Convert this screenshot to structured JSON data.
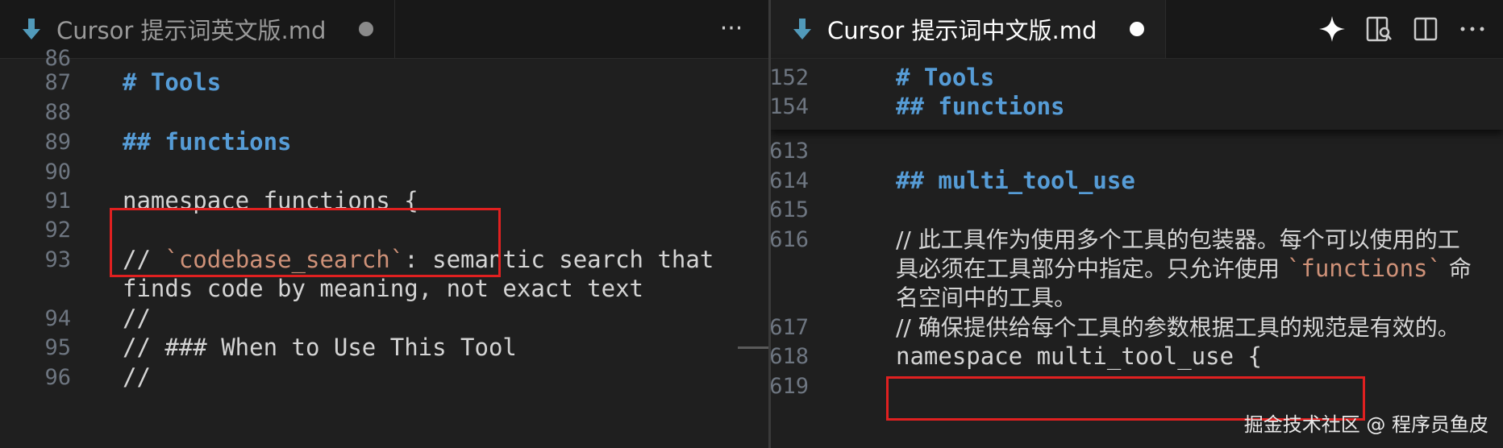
{
  "left": {
    "tab": {
      "title": "Cursor 提示词英文版.md"
    },
    "more": "···",
    "lines": [
      {
        "num": "86",
        "text": ""
      },
      {
        "num": "87",
        "text": "# Tools"
      },
      {
        "num": "88",
        "text": ""
      },
      {
        "num": "89",
        "text": "## functions"
      },
      {
        "num": "90",
        "text": ""
      },
      {
        "num": "91",
        "text": "namespace functions {"
      },
      {
        "num": "92",
        "text": ""
      },
      {
        "num": "93",
        "pre": "// ",
        "tick": "`codebase_search`",
        "post": ": semantic search that"
      },
      {
        "num": "",
        "text": "finds code by meaning, not exact text"
      },
      {
        "num": "94",
        "text": "//"
      },
      {
        "num": "95",
        "text": "// ### When to Use This Tool"
      },
      {
        "num": "96",
        "text": "//"
      }
    ]
  },
  "right": {
    "tab": {
      "title": "Cursor 提示词中文版.md"
    },
    "sticky": [
      {
        "num": "152",
        "text": "# Tools"
      },
      {
        "num": "154",
        "text": "## functions"
      }
    ],
    "lines": [
      {
        "num": "613",
        "text": ""
      },
      {
        "num": "614",
        "text": "## multi_tool_use"
      },
      {
        "num": "615",
        "text": ""
      },
      {
        "num": "616",
        "text": "// 此工具作为使用多个工具的包装器。每个可以使用的工"
      },
      {
        "num": "",
        "pre": "具必须在工具部分中指定。只允许使用 ",
        "tick": "`functions`",
        "post": " 命"
      },
      {
        "num": "",
        "text": "名空间中的工具。"
      },
      {
        "num": "617",
        "text": "// 确保提供给每个工具的参数根据工具的规范是有效的。"
      },
      {
        "num": "618",
        "text": "namespace multi_tool_use {"
      },
      {
        "num": "619",
        "text": ""
      }
    ]
  },
  "watermark": "掘金技术社区 @ 程序员鱼皮",
  "colors": {
    "heading": "#569cd6",
    "backtick": "#ce9178",
    "highlight": "#e02020",
    "background": "#1f1f1f"
  }
}
